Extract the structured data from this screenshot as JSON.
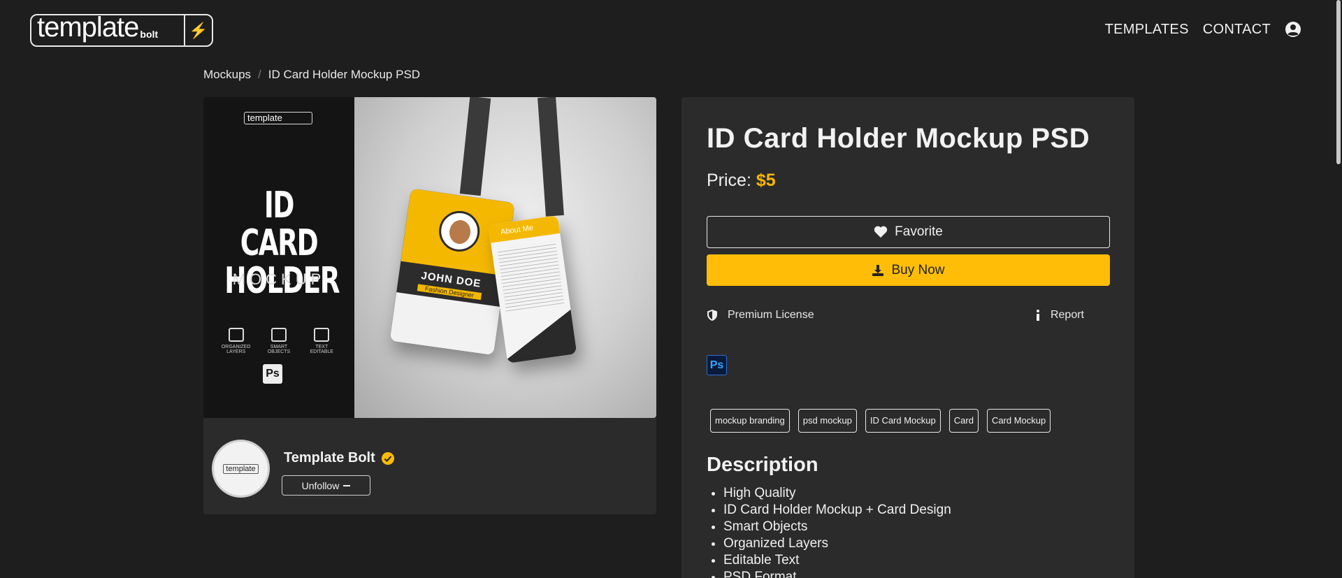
{
  "header": {
    "logo": {
      "word": "template",
      "sub": "bolt",
      "icon": "lightning-icon"
    },
    "nav": [
      {
        "label": "TEMPLATES"
      },
      {
        "label": "CONTACT"
      }
    ],
    "user_icon": "user-circle-icon"
  },
  "breadcrumb": {
    "items": [
      "Mockups",
      "ID Card Holder Mockup PSD"
    ],
    "separator": "/"
  },
  "preview": {
    "logo_text": "template",
    "title": "ID CARD HOLDER",
    "subtitle": "MOCKUP",
    "features": [
      "ORGANIZED LAYERS",
      "SMART OBJECTS",
      "TEXT EDITABLE"
    ],
    "ps_label": "Ps",
    "card_name": "JOHN DOE",
    "card_role": "Fashion Designer",
    "card_back_title": "About Me"
  },
  "author": {
    "name": "Template Bolt",
    "avatar_text": "template",
    "follow_button": "Unfollow",
    "verified_icon": "verified-check-icon"
  },
  "product": {
    "title": "ID Card Holder Mockup PSD",
    "price_label": "Price:",
    "price_value": "$5",
    "favorite_button": "Favorite",
    "buy_button": "Buy Now",
    "license": "Premium License",
    "report": "Report",
    "software_badge": "Ps",
    "tags": [
      "mockup branding",
      "psd mockup",
      "ID Card Mockup",
      "Card",
      "Card Mockup"
    ],
    "description_title": "Description",
    "description_items": [
      "High Quality",
      "ID Card Holder Mockup + Card Design",
      "Smart Objects",
      "Organized Layers",
      "Editable Text",
      "PSD Format"
    ]
  },
  "colors": {
    "background": "#1e1e1e",
    "panel": "#2b2b2b",
    "accent": "#ffbd08",
    "text": "#e8e8e8"
  }
}
